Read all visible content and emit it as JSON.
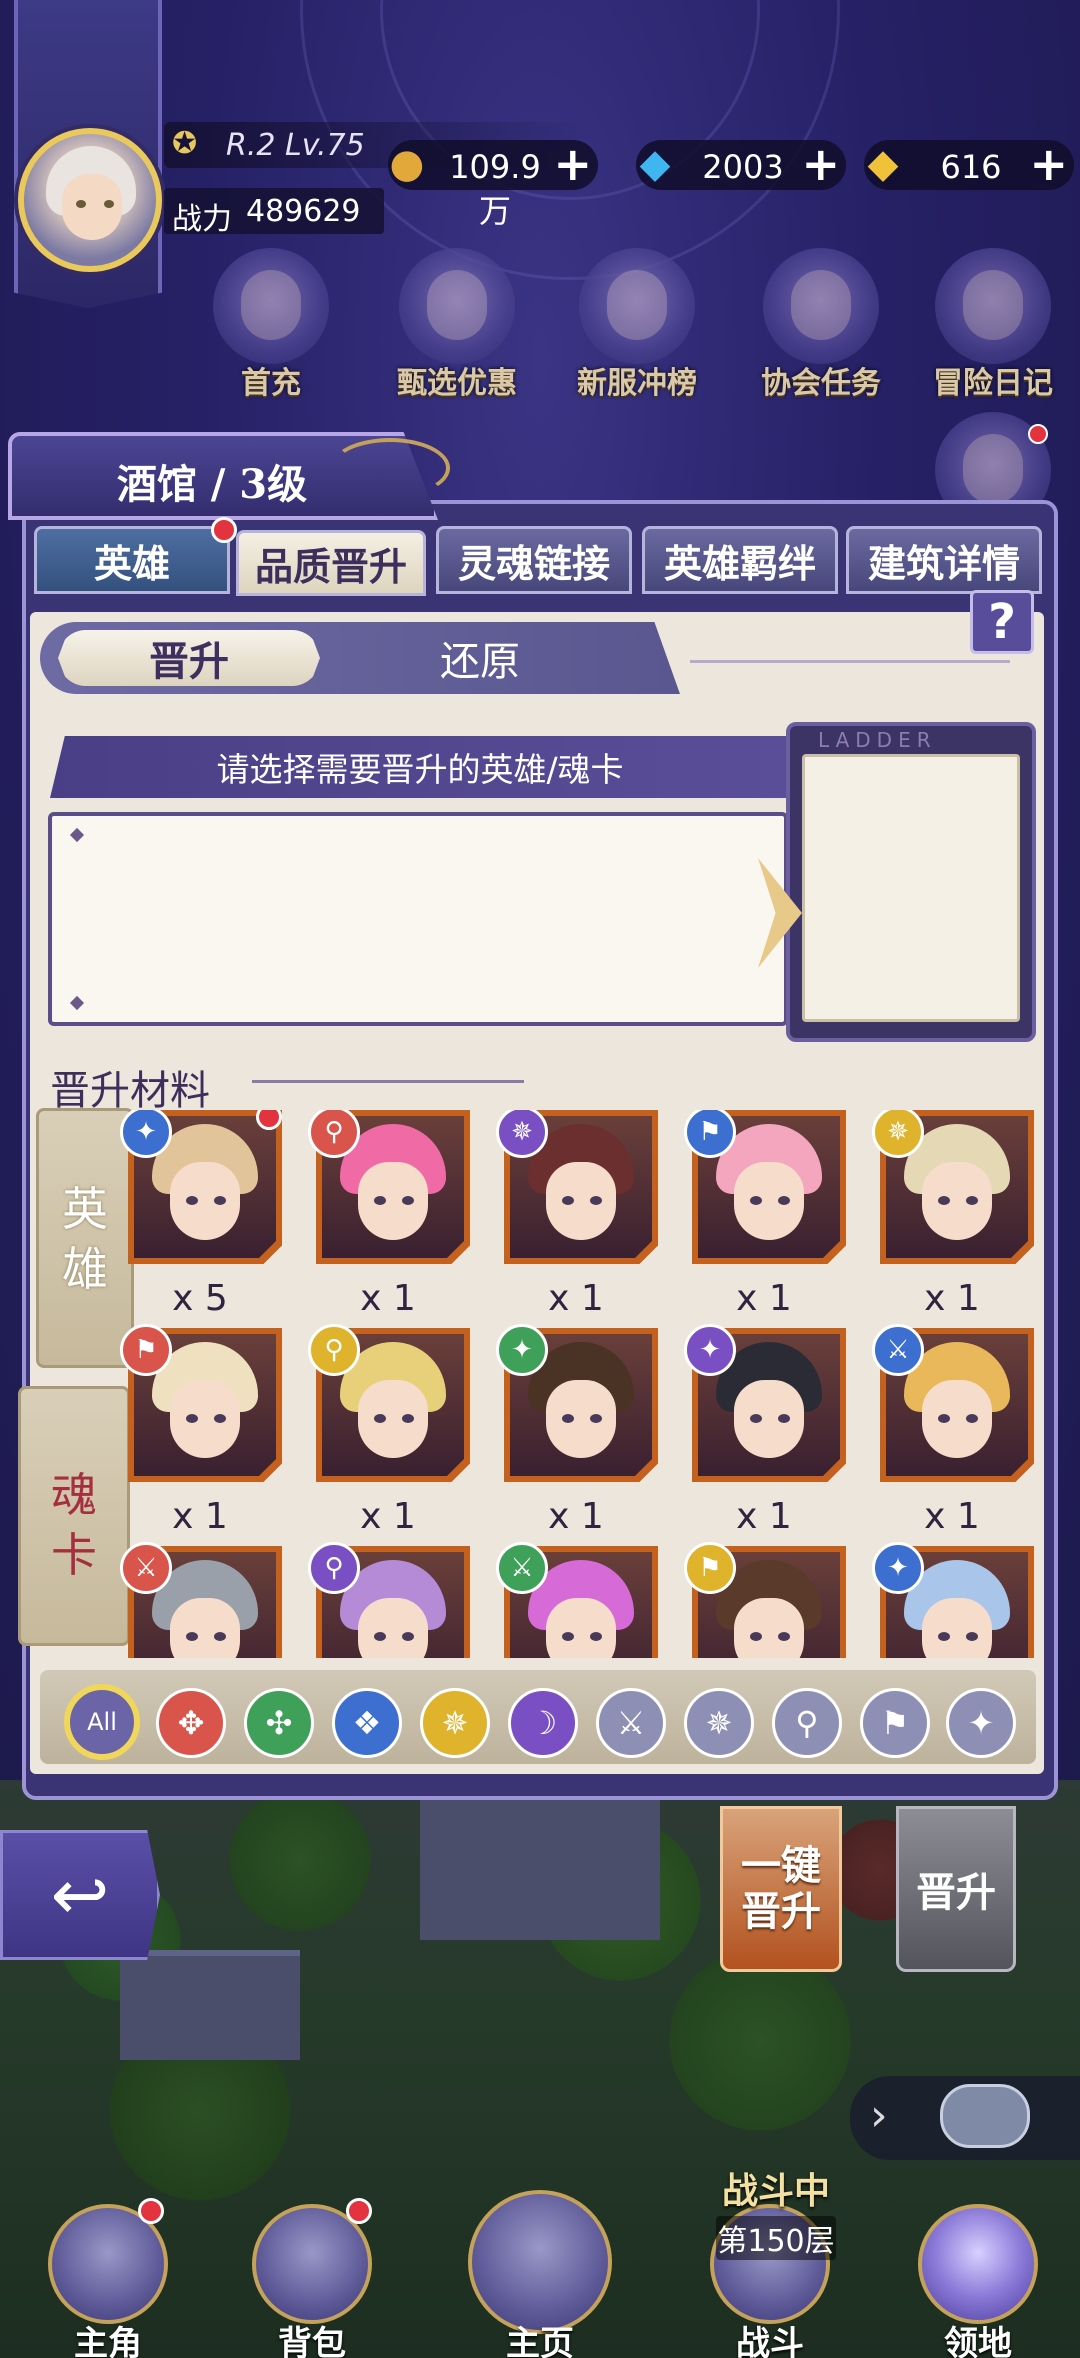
{
  "player": {
    "rank_level": "R.2 Lv.75",
    "power_label": "战力",
    "power_value": "489629"
  },
  "currencies": [
    {
      "icon": "gold-coin-icon",
      "value": "109.9万",
      "plus": "+"
    },
    {
      "icon": "blue-diamond-icon",
      "value": "2003",
      "plus": "+"
    },
    {
      "icon": "gold-crystal-icon",
      "value": "616",
      "plus": "+"
    }
  ],
  "events": [
    {
      "label": "首充"
    },
    {
      "label": "甄选优惠"
    },
    {
      "label": "新服冲榜"
    },
    {
      "label": "协会任务"
    },
    {
      "label": "冒险日记"
    }
  ],
  "panel": {
    "title": "酒馆 / 3级",
    "help": "?",
    "tabs": [
      {
        "label": "英雄",
        "badge": true
      },
      {
        "label": "品质晋升",
        "active": true
      },
      {
        "label": "灵魂链接"
      },
      {
        "label": "英雄羁绊"
      },
      {
        "label": "建筑详情"
      }
    ],
    "subtabs": {
      "active": "晋升",
      "other": "还原"
    },
    "instruction": "请选择需要晋升的英雄/魂卡",
    "ladder_text": "LADDER",
    "materials_title": "晋升材料",
    "side_tabs": [
      {
        "label_top": "英",
        "label_bottom": "雄",
        "active": false
      },
      {
        "label_top": "魂",
        "label_bottom": "卡",
        "active": true
      }
    ]
  },
  "materials": [
    {
      "qty": "x 5",
      "class_color": "#3d6fd0",
      "class_icon": "✦",
      "hair": "#e2c49a",
      "badge": true
    },
    {
      "qty": "x 1",
      "class_color": "#d9544a",
      "class_icon": "⚲",
      "hair": "#f06aa6"
    },
    {
      "qty": "x 1",
      "class_color": "#7a4fc4",
      "class_icon": "✵",
      "hair": "#6b2f2f"
    },
    {
      "qty": "x 1",
      "class_color": "#3d6fd0",
      "class_icon": "⚑",
      "hair": "#f3a6be"
    },
    {
      "qty": "x 1",
      "class_color": "#e0b32c",
      "class_icon": "✵",
      "hair": "#e4d8b5"
    },
    {
      "qty": "x 1",
      "class_color": "#d9544a",
      "class_icon": "⚑",
      "hair": "#efe0c0"
    },
    {
      "qty": "x 1",
      "class_color": "#e0b32c",
      "class_icon": "⚲",
      "hair": "#e8d07a"
    },
    {
      "qty": "x 1",
      "class_color": "#3fa05a",
      "class_icon": "✦",
      "hair": "#4a3324"
    },
    {
      "qty": "x 1",
      "class_color": "#7a4fc4",
      "class_icon": "✦",
      "hair": "#2b2b36"
    },
    {
      "qty": "x 1",
      "class_color": "#3d6fd0",
      "class_icon": "⚔",
      "hair": "#e8b85a"
    },
    {
      "qty": "",
      "class_color": "#d9544a",
      "class_icon": "⚔",
      "hair": "#9aa0aa"
    },
    {
      "qty": "",
      "class_color": "#7a4fc4",
      "class_icon": "⚲",
      "hair": "#b58ad6"
    },
    {
      "qty": "",
      "class_color": "#3fa05a",
      "class_icon": "⚔",
      "hair": "#d66ad6"
    },
    {
      "qty": "",
      "class_color": "#e0b32c",
      "class_icon": "⚑",
      "hair": "#5a3a2a"
    },
    {
      "qty": "",
      "class_color": "#3d6fd0",
      "class_icon": "✦",
      "hair": "#a9c6ea"
    }
  ],
  "filters": [
    {
      "label": "All",
      "color": "#6b65a8",
      "icon": ""
    },
    {
      "label": "",
      "color": "#d9544a",
      "icon": "✥"
    },
    {
      "label": "",
      "color": "#3fa05a",
      "icon": "✣"
    },
    {
      "label": "",
      "color": "#3d6fd0",
      "icon": "❖"
    },
    {
      "label": "",
      "color": "#e0b32c",
      "icon": "✵"
    },
    {
      "label": "",
      "color": "#7a4fc4",
      "icon": "☽"
    },
    {
      "label": "",
      "color": "#8e8fb5",
      "icon": "⚔"
    },
    {
      "label": "",
      "color": "#8e8fb5",
      "icon": "✵"
    },
    {
      "label": "",
      "color": "#8e8fb5",
      "icon": "⚲"
    },
    {
      "label": "",
      "color": "#8e8fb5",
      "icon": "⚑"
    },
    {
      "label": "",
      "color": "#8e8fb5",
      "icon": "✦"
    }
  ],
  "actions": {
    "one_key_line1": "一键",
    "one_key_line2": "晋升",
    "promote": "晋升"
  },
  "battle": {
    "status": "战斗中",
    "floor": "第150层"
  },
  "nav": [
    {
      "label": "主角",
      "badge": true
    },
    {
      "label": "背包",
      "badge": true
    },
    {
      "label": "主页"
    },
    {
      "label": "战斗"
    },
    {
      "label": "领地"
    }
  ]
}
